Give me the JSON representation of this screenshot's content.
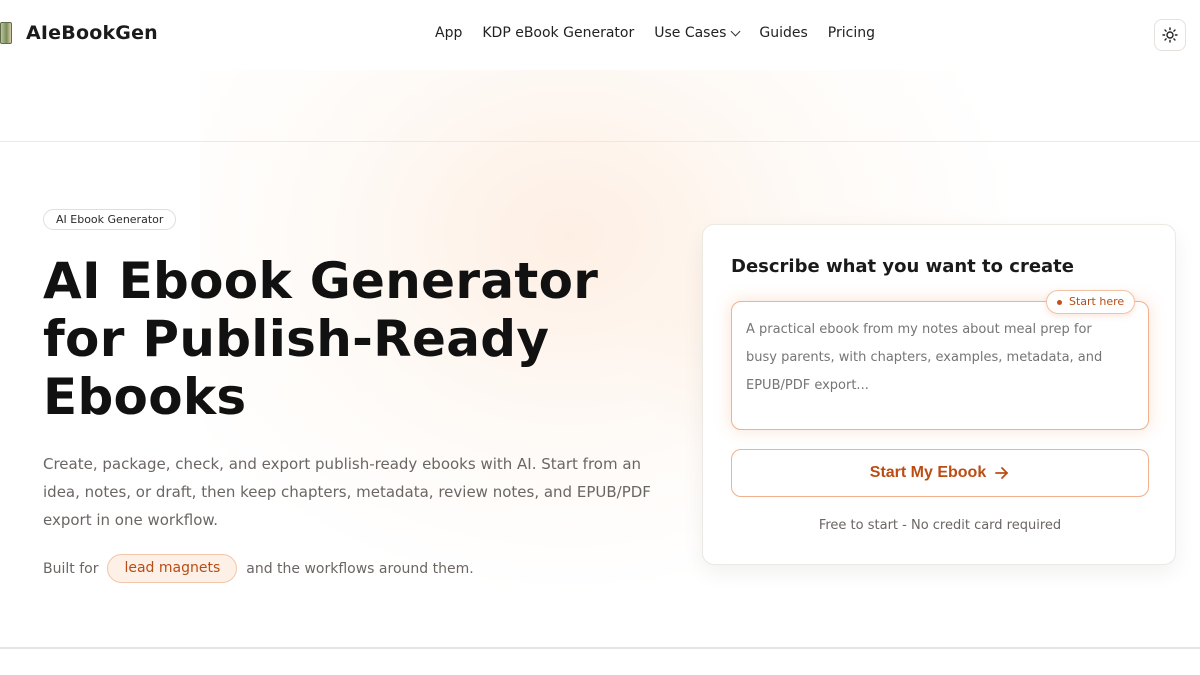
{
  "brand": {
    "name": "AIeBookGen"
  },
  "nav": {
    "items": [
      {
        "label": "App"
      },
      {
        "label": "KDP eBook Generator"
      },
      {
        "label": "Use Cases",
        "has_dropdown": true
      },
      {
        "label": "Guides"
      },
      {
        "label": "Pricing"
      }
    ],
    "theme_toggle_icon": "sun-icon"
  },
  "hero": {
    "badge": "AI Ebook Generator",
    "title_lines": [
      "AI Ebook Generator",
      "for Publish-Ready",
      "Ebooks"
    ],
    "description": "Create, package, check, and export publish-ready ebooks with AI. Start from an idea, notes, or draft, then keep chapters, metadata, review notes, and EPUB/PDF export in one workflow.",
    "built_for_prefix": "Built for",
    "built_for_pill": "lead magnets",
    "built_for_suffix": "and the workflows around them."
  },
  "card": {
    "title": "Describe what you want to create",
    "start_here": "Start here",
    "placeholder": "A practical ebook from my notes about meal prep for busy parents, with chapters, examples, metadata, and EPUB/PDF export...",
    "cta_label": "Start My Ebook",
    "note": "Free to start - No credit card required"
  },
  "colors": {
    "accent": "#bb4d14",
    "accent_border": "#f0b18c",
    "pill_bg": "#fdf0e6"
  }
}
